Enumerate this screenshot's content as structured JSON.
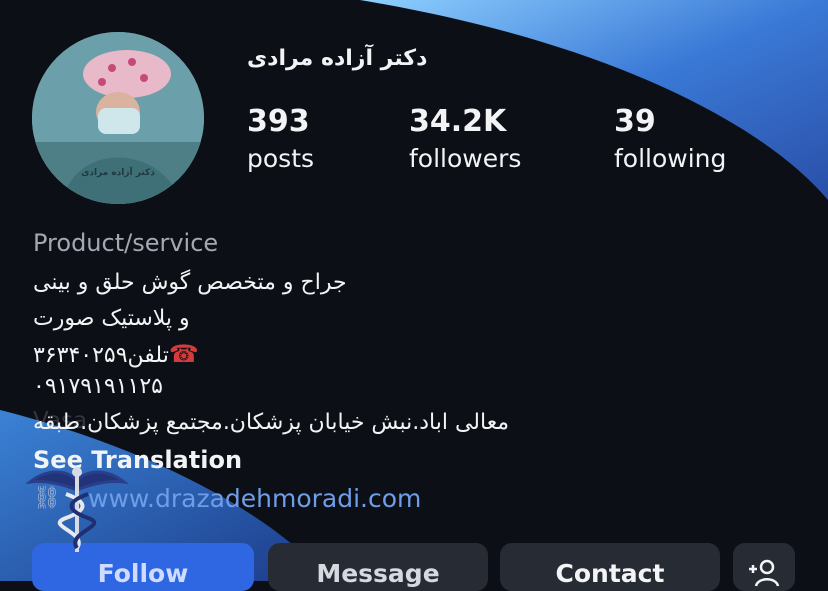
{
  "profile": {
    "name": "دکتر آزاده مرادی",
    "avatar_caption": "دکتر آزاده مرادی",
    "category": "Product/service"
  },
  "stats": {
    "posts": {
      "value": "393",
      "label": "posts"
    },
    "followers": {
      "value": "34.2K",
      "label": "followers"
    },
    "following": {
      "value": "39",
      "label": "following"
    }
  },
  "bio": {
    "line1": "جراح و متخصص گوش حلق و بینی",
    "line2": "و پلاستیک صورت",
    "phone_label": "تلفن",
    "phone_number": "۳۶۳۴۰۲۵۹",
    "mobile": "۰۹۱۷۹۱۹۱۱۲۵",
    "address": "معالی اباد.نبش خیابان پزشکان.مجتمع پزشکان.طبقه",
    "watermark": "Vasa",
    "see_translation": "See Translation"
  },
  "link": {
    "url": "www.drazadehmoradi.com"
  },
  "buttons": {
    "follow": "Follow",
    "message": "Message",
    "contact": "Contact"
  },
  "colors": {
    "background": "#0c0f16",
    "accent_blue": "#2e67e1",
    "link_blue": "#6f9ee8",
    "button_gray": "#272b33"
  },
  "icons": {
    "phone": "telephone-icon",
    "add_person": "add-person-icon",
    "link": "link-icon",
    "overlay_logo": "caduceus-icon"
  }
}
